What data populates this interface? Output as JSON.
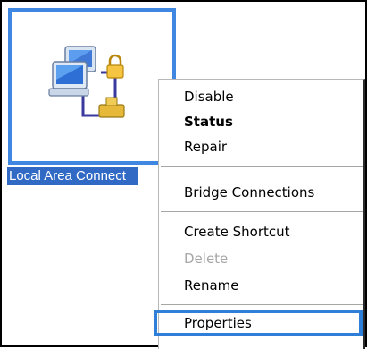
{
  "desktop_icon": {
    "label": "Local Area Connect",
    "icon": "network-connection-icon"
  },
  "context_menu": {
    "items": [
      {
        "label": "Disable"
      },
      {
        "label": "Status",
        "default": true
      },
      {
        "label": "Repair"
      },
      {
        "label": "Bridge Connections"
      },
      {
        "label": "Create Shortcut"
      },
      {
        "label": "Delete",
        "enabled": false
      },
      {
        "label": "Rename"
      },
      {
        "label": "Properties",
        "highlighted": true
      }
    ]
  },
  "colors": {
    "selection_blue": "#316ac5",
    "highlight_border": "#2f7fd8",
    "disabled_text": "#a7a7a7"
  }
}
